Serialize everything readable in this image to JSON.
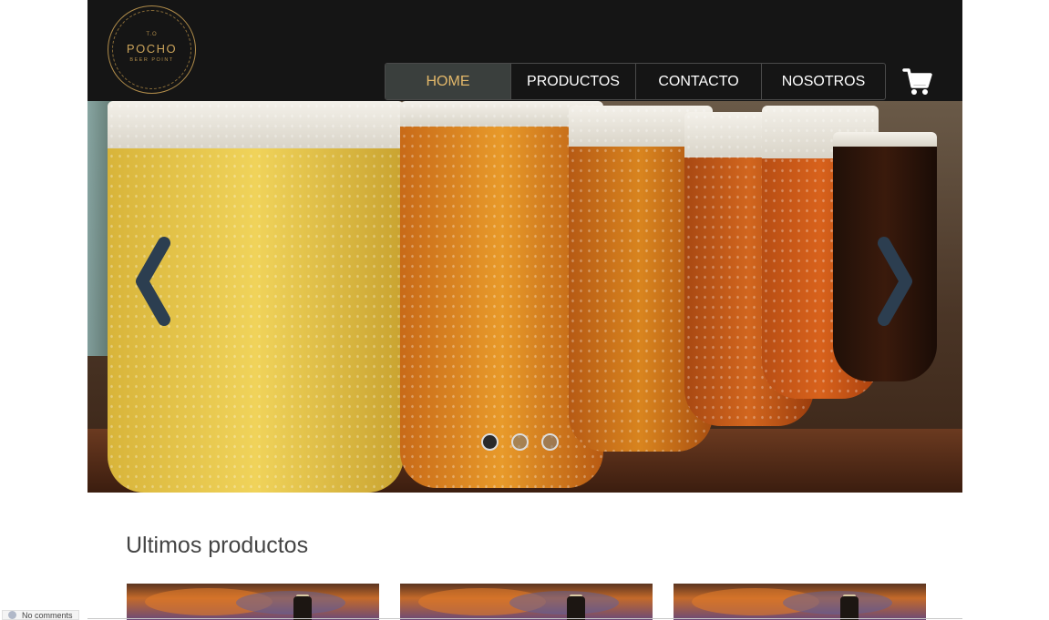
{
  "logo": {
    "top": "T.O",
    "main": "POCHO",
    "sub": "BEER POINT"
  },
  "nav": {
    "items": [
      {
        "label": "HOME",
        "active": true
      },
      {
        "label": "PRODUCTOS",
        "active": false
      },
      {
        "label": "CONTACTO",
        "active": false
      },
      {
        "label": "NOSOTROS",
        "active": false
      }
    ],
    "cart_icon": "cart-icon"
  },
  "carousel": {
    "slides": 3,
    "active_slide": 1,
    "prev_icon": "chevron-left-icon",
    "next_icon": "chevron-right-icon"
  },
  "section": {
    "title": "Ultimos productos"
  },
  "comments_widget": {
    "label": "No comments"
  },
  "colors": {
    "header_bg": "#151515",
    "accent_gold": "#e3b86a",
    "active_nav_bg": "#3a3f3d",
    "text_dark": "#444444"
  }
}
